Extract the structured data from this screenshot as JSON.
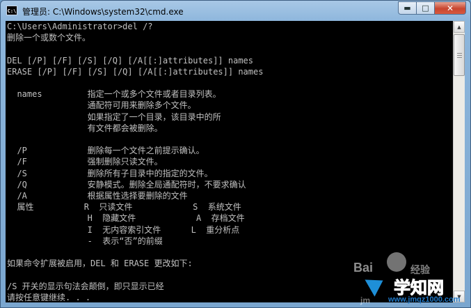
{
  "window": {
    "title": "管理员: C:\\Windows\\system32\\cmd.exe",
    "icon": "cmd-prompt-icon",
    "controls": {
      "minimize": "minimize-icon",
      "maximize": "maximize-icon",
      "close": "close-icon"
    }
  },
  "console": {
    "lines": [
      "C:\\Users\\Administrator>del /?",
      "删除一个或数个文件。",
      "",
      "DEL [/P] [/F] [/S] [/Q] [/A[[:]attributes]] names",
      "ERASE [/P] [/F] [/S] [/Q] [/A[[:]attributes]] names",
      "",
      "  names         指定一个或多个文件或者目录列表。",
      "                通配符可用来删除多个文件。",
      "                如果指定了一个目录，该目录中的所",
      "                有文件都会被删除。",
      "",
      "  /P            删除每一个文件之前提示确认。",
      "  /F            强制删除只读文件。",
      "  /S            删除所有子目录中的指定的文件。",
      "  /Q            安静模式。删除全局通配符时，不要求确认",
      "  /A            根据属性选择要删除的文件",
      "  属性          R  只读文件            S  系统文件",
      "                H  隐藏文件            A  存档文件",
      "                I  无内容索引文件      L  重分析点",
      "                -  表示“否”的前缀",
      "",
      "如果命令扩展被启用，DEL 和 ERASE 更改如下:",
      "",
      "/S 开关的显示句法会颠倒，即只显示已经",
      "请按任意键继续. . ."
    ]
  },
  "watermark": {
    "baidu": "Bai",
    "jingyan": "经验",
    "site_title": "学知网",
    "site_url": "www.jmqz1000.com",
    "jm": "jm"
  },
  "colors": {
    "console_bg": "#000000",
    "console_fg": "#c0c0c0",
    "close_button": "#c8452f",
    "title_bar": "#8db6dc"
  }
}
